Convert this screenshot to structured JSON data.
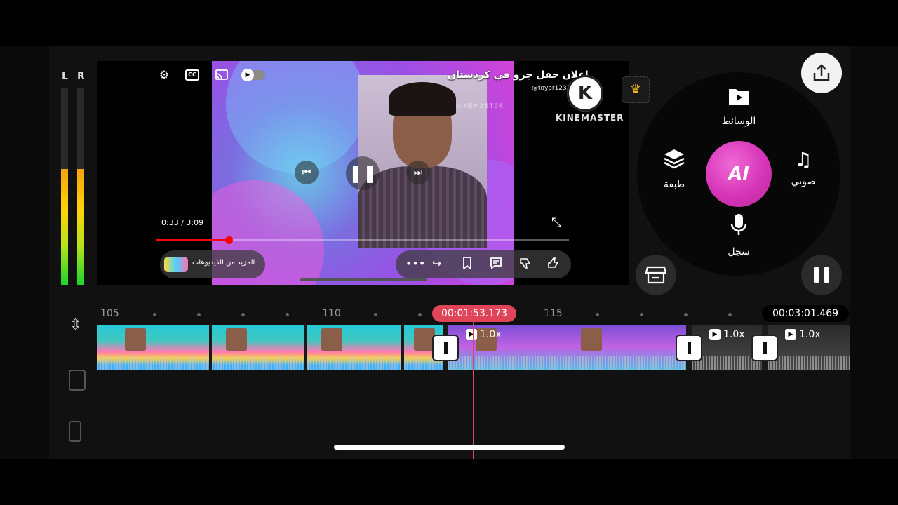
{
  "vu_meter": {
    "left_label": "L",
    "right_label": "R",
    "left_level": 0.59,
    "right_level": 0.59
  },
  "preview": {
    "video_title": "إعلان حفل جرو في كردستان",
    "channel": "@toyor12321",
    "watermark": "KINEMASTER",
    "logo_letter": "K",
    "logo_text": "KINEMASTER",
    "time_display": "0:33 / 3:09",
    "progress_fraction": 0.175,
    "more_videos_label": "المزيد من الفيديوهات",
    "icons": {
      "settings": "gear-icon",
      "cc": "CC",
      "cast": "cast-icon",
      "autoplay": "toggle-icon",
      "prev": "previous-icon",
      "pause": "pause-icon",
      "next": "next-icon",
      "collapse": "collapse-icon",
      "more": "•••",
      "share": "↪",
      "save": "bookmark-icon",
      "comment": "comment-icon",
      "dislike": "dislike-icon",
      "like": "like-icon"
    }
  },
  "wheel": {
    "media_label": "الوسائط",
    "audio_label": "صوتي",
    "layer_label": "طبقة",
    "record_label": "سجل",
    "ai_label": "AI",
    "accent_color": "#d635b8"
  },
  "timeline": {
    "ruler_labels": [
      "105",
      "110",
      "115"
    ],
    "current_time": "00:01:53.173",
    "total_time": "00:03:01.469",
    "speed_labels": [
      "1.0x",
      "1.0x",
      "1.0x"
    ],
    "playhead_color": "#e04458"
  }
}
